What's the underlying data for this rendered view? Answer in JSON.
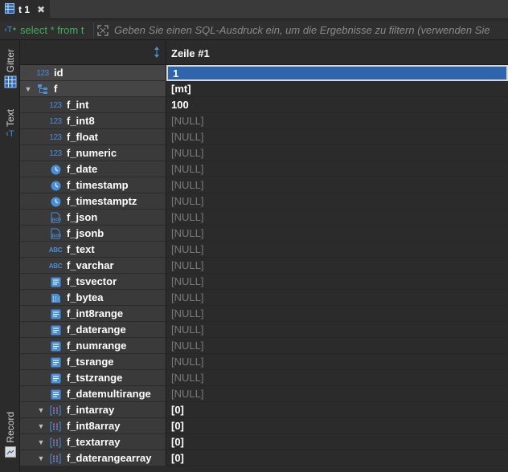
{
  "tab": {
    "title": "t 1",
    "close": "✖"
  },
  "filter": {
    "query": "select * from t",
    "placeholder": "Geben Sie einen SQL-Ausdruck ein, um die Ergebnisse zu filtern (verwenden Sie"
  },
  "side_tabs": {
    "grid": "Gitter",
    "text": "Text",
    "record": "Record"
  },
  "grid": {
    "column_header": "Zeile  #1",
    "rows": [
      {
        "name": "id",
        "type_icon": "numeric-icon",
        "value": "1",
        "indent": 0,
        "selected": true
      },
      {
        "name": "f",
        "type_icon": "struct-icon",
        "value": "[mt]",
        "indent": 0,
        "expanded": true
      },
      {
        "name": "f_int",
        "type_icon": "numeric-icon",
        "value": "100",
        "indent": 1
      },
      {
        "name": "f_int8",
        "type_icon": "numeric-icon",
        "value": "[NULL]",
        "indent": 1,
        "null": true
      },
      {
        "name": "f_float",
        "type_icon": "numeric-icon",
        "value": "[NULL]",
        "indent": 1,
        "null": true
      },
      {
        "name": "f_numeric",
        "type_icon": "numeric-icon",
        "value": "[NULL]",
        "indent": 1,
        "null": true
      },
      {
        "name": "f_date",
        "type_icon": "clock-icon",
        "value": "[NULL]",
        "indent": 1,
        "null": true
      },
      {
        "name": "f_timestamp",
        "type_icon": "clock-icon",
        "value": "[NULL]",
        "indent": 1,
        "null": true
      },
      {
        "name": "f_timestamptz",
        "type_icon": "clock-icon",
        "value": "[NULL]",
        "indent": 1,
        "null": true
      },
      {
        "name": "f_json",
        "type_icon": "json-icon",
        "value": "[NULL]",
        "indent": 1,
        "null": true
      },
      {
        "name": "f_jsonb",
        "type_icon": "json-icon",
        "value": "[NULL]",
        "indent": 1,
        "null": true
      },
      {
        "name": "f_text",
        "type_icon": "text-icon",
        "value": "[NULL]",
        "indent": 1,
        "null": true
      },
      {
        "name": "f_varchar",
        "type_icon": "text-icon",
        "value": "[NULL]",
        "indent": 1,
        "null": true
      },
      {
        "name": "f_tsvector",
        "type_icon": "document-icon",
        "value": "[NULL]",
        "indent": 1,
        "null": true
      },
      {
        "name": "f_bytea",
        "type_icon": "binary-icon",
        "value": "[NULL]",
        "indent": 1,
        "null": true
      },
      {
        "name": "f_int8range",
        "type_icon": "document-icon",
        "value": "[NULL]",
        "indent": 1,
        "null": true
      },
      {
        "name": "f_daterange",
        "type_icon": "document-icon",
        "value": "[NULL]",
        "indent": 1,
        "null": true
      },
      {
        "name": "f_numrange",
        "type_icon": "document-icon",
        "value": "[NULL]",
        "indent": 1,
        "null": true
      },
      {
        "name": "f_tsrange",
        "type_icon": "document-icon",
        "value": "[NULL]",
        "indent": 1,
        "null": true
      },
      {
        "name": "f_tstzrange",
        "type_icon": "document-icon",
        "value": "[NULL]",
        "indent": 1,
        "null": true
      },
      {
        "name": "f_datemultirange",
        "type_icon": "document-icon",
        "value": "[NULL]",
        "indent": 1,
        "null": true
      },
      {
        "name": "f_intarray",
        "type_icon": "array-icon",
        "value": "[0]",
        "indent": 1,
        "collapsed": true
      },
      {
        "name": "f_int8array",
        "type_icon": "array-icon",
        "value": "[0]",
        "indent": 1,
        "collapsed": true
      },
      {
        "name": "f_textarray",
        "type_icon": "array-icon",
        "value": "[0]",
        "indent": 1,
        "collapsed": true
      },
      {
        "name": "f_daterangearray",
        "type_icon": "array-icon",
        "value": "[0]",
        "indent": 1,
        "collapsed": true
      }
    ]
  },
  "colors": {
    "accent": "#2f65ac",
    "icon_blue": "#4a8fd8",
    "query_green": "#3fae5a",
    "null_gray": "#7a7a7a"
  }
}
